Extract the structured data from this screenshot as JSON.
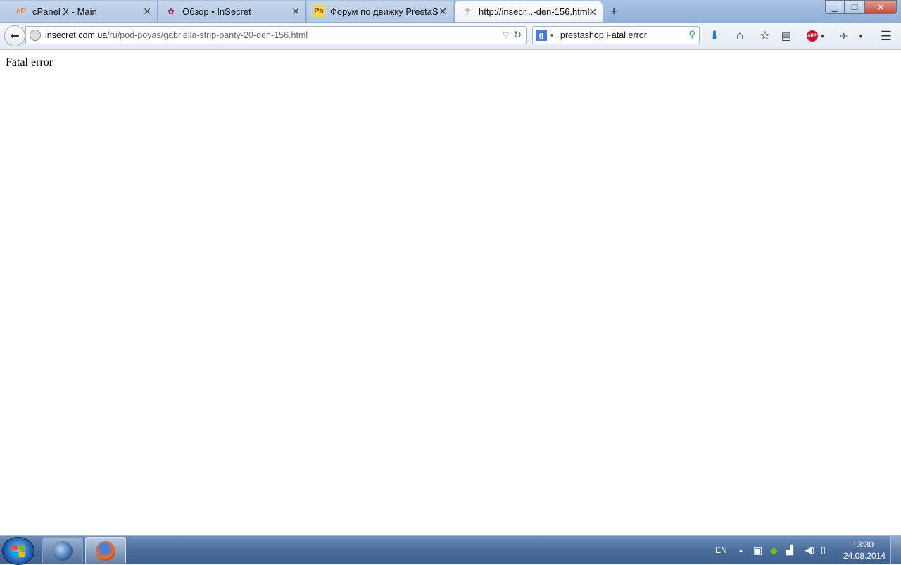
{
  "browser": {
    "tabs": [
      {
        "label": "cPanel X - Main",
        "icon": "cpanel-icon",
        "active": false
      },
      {
        "label": "Обзор • InSecret",
        "icon": "insecret-icon",
        "active": false
      },
      {
        "label": "Форум по движку PrestaS...",
        "icon": "prestashop-icon",
        "active": false
      },
      {
        "label": "http://insecr...-den-156.html",
        "icon": "question-icon",
        "active": true
      }
    ],
    "url": {
      "host": "insecret.com.ua",
      "path": "/ru/pod-poyas/gabriella-strip-panty-20-den-156.html"
    },
    "search": {
      "engine": "google-icon",
      "value": "prestashop Fatal error"
    },
    "toolbar_icons": [
      "download-icon",
      "home-icon",
      "bookmark-star-icon",
      "reading-list-icon",
      "adblock-icon",
      "extension-icon",
      "menu-icon"
    ],
    "adblock_label": "ABP"
  },
  "page": {
    "error_text": "Fatal error"
  },
  "taskbar": {
    "apps": [
      "thunderbird-icon",
      "firefox-icon"
    ],
    "language": "EN",
    "time": "13:30",
    "date": "24.08.2014"
  },
  "colors": {
    "titlebar": "#a9c2e2",
    "taskbar": "#4a6d9c",
    "abp": "#c8102e"
  }
}
